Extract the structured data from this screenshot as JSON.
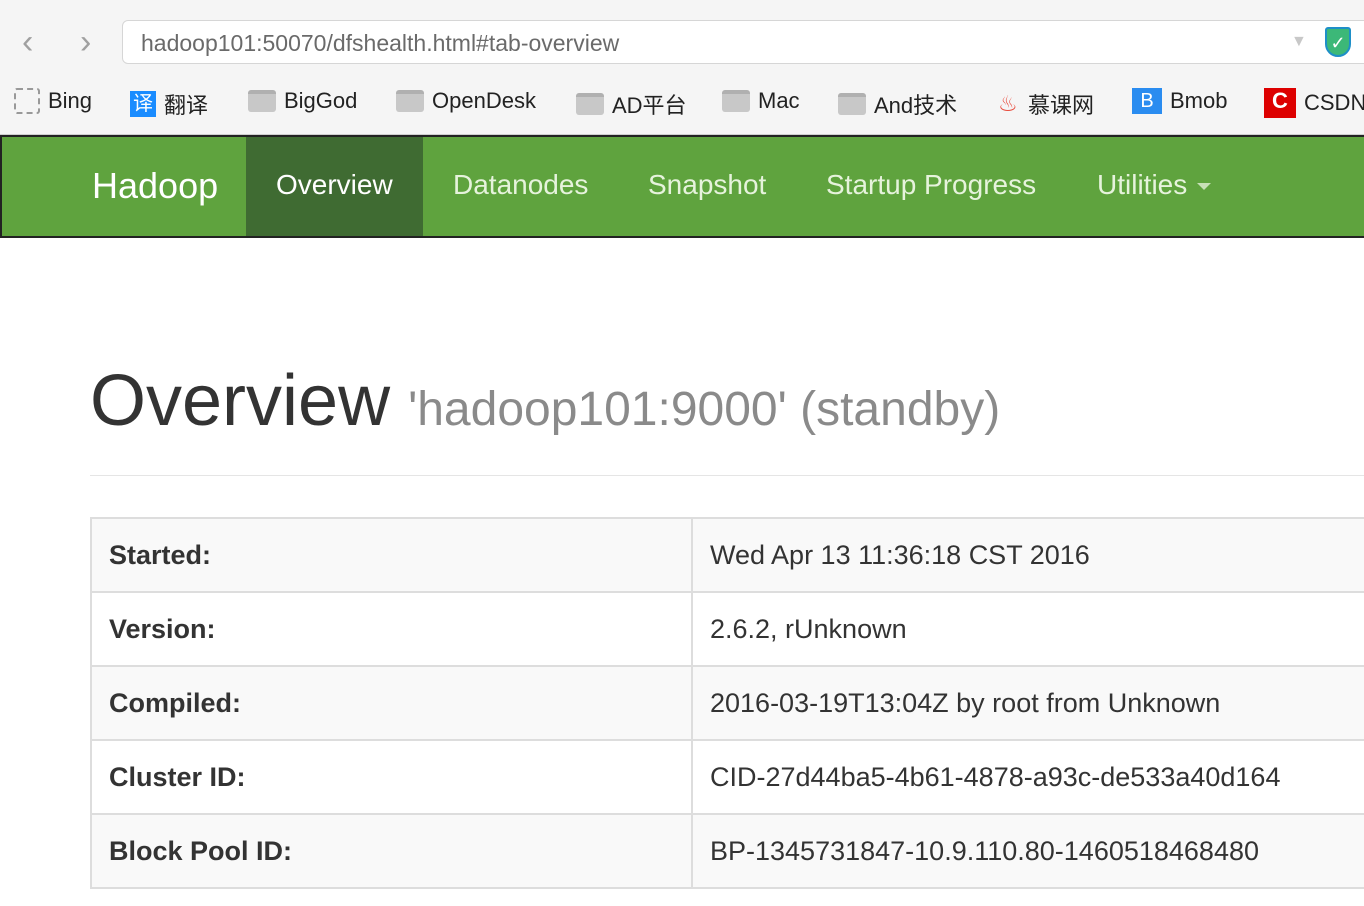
{
  "browser": {
    "url": "hadoop101:50070/dfshealth.html#tab-overview",
    "bookmarks": [
      {
        "label": "Bing",
        "icon": "dashed-box-icon"
      },
      {
        "label": "翻译",
        "icon": "translate-icon"
      },
      {
        "label": "BigGod",
        "icon": "folder-icon"
      },
      {
        "label": "OpenDesk",
        "icon": "folder-icon"
      },
      {
        "label": "AD平台",
        "icon": "folder-icon"
      },
      {
        "label": "Mac",
        "icon": "folder-icon"
      },
      {
        "label": "And技术",
        "icon": "folder-icon"
      },
      {
        "label": "慕课网",
        "icon": "flame-icon"
      },
      {
        "label": "Bmob",
        "icon": "bmob-icon"
      },
      {
        "label": "CSDN",
        "icon": "csdn-icon"
      }
    ]
  },
  "nav": {
    "brand": "Hadoop",
    "tabs": [
      "Overview",
      "Datanodes",
      "Snapshot",
      "Startup Progress",
      "Utilities"
    ],
    "active": "Overview"
  },
  "page": {
    "title": "Overview",
    "subtitle": "'hadoop101:9000' (standby)"
  },
  "info": [
    {
      "k": "Started:",
      "v": "Wed Apr 13 11:36:18 CST 2016"
    },
    {
      "k": "Version:",
      "v": "2.6.2, rUnknown"
    },
    {
      "k": "Compiled:",
      "v": "2016-03-19T13:04Z by root from Unknown"
    },
    {
      "k": "Cluster ID:",
      "v": "CID-27d44ba5-4b61-4878-a93c-de533a40d164"
    },
    {
      "k": "Block Pool ID:",
      "v": "BP-1345731847-10.9.110.80-1460518468480"
    }
  ],
  "colors": {
    "navbar": "#5fa33e",
    "active_tab": "#3f6b32"
  }
}
